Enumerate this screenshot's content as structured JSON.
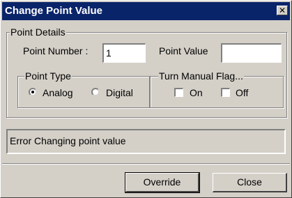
{
  "window": {
    "title": "Change Point Value",
    "close_glyph": "✕"
  },
  "point_details": {
    "legend": "Point Details",
    "point_number_label": "Point Number :",
    "point_number_value": "1",
    "point_value_label": "Point Value",
    "point_value_value": ""
  },
  "point_type": {
    "legend": "Point Type",
    "options": [
      {
        "label": "Analog",
        "selected": true
      },
      {
        "label": "Digital",
        "selected": false
      }
    ]
  },
  "manual_flag": {
    "legend": "Turn Manual Flag...",
    "options": [
      {
        "label": "On",
        "checked": false
      },
      {
        "label": "Off",
        "checked": false
      }
    ]
  },
  "status": {
    "message": "Error Changing point value"
  },
  "buttons": {
    "override": "Override",
    "close": "Close"
  },
  "colors": {
    "titlebar": "#0a246a",
    "face": "#d4d0c8"
  }
}
